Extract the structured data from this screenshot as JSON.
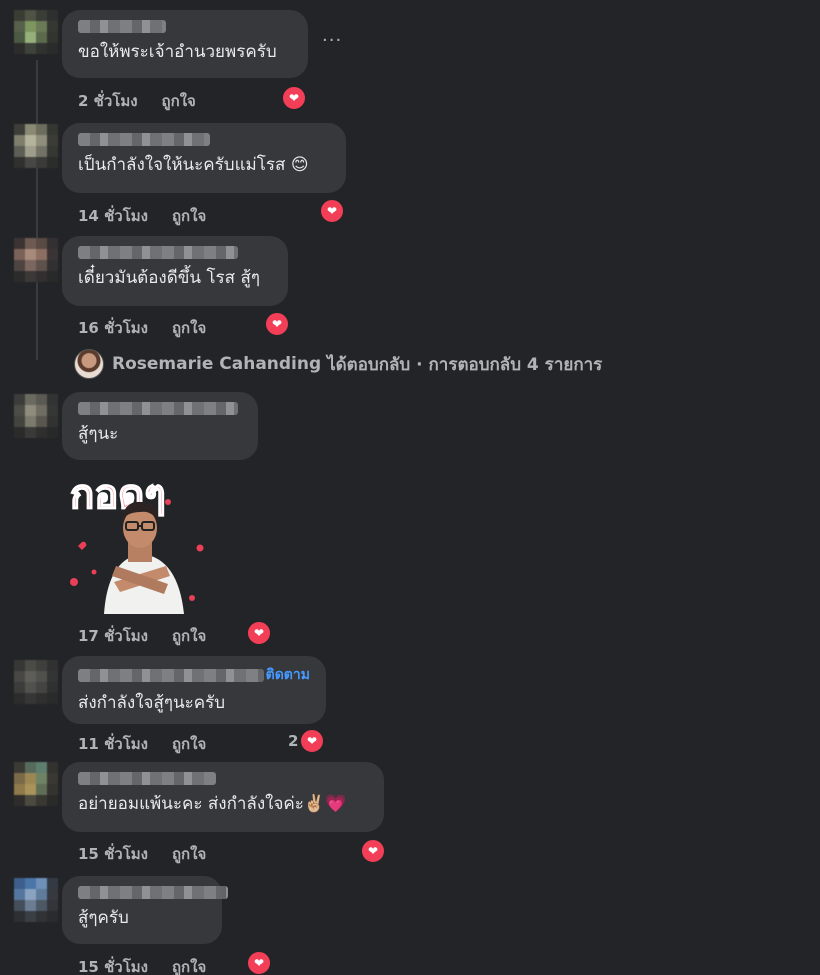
{
  "comments": [
    {
      "text": "ขอให้พระเจ้าอำนวยพรครับ",
      "time": "2 ชั่วโมง",
      "like": "ถูกใจ"
    },
    {
      "text": "เป็นกำลังใจให้นะครับแม่โรส",
      "emoji": "😊",
      "time": "14 ชั่วโมง",
      "like": "ถูกใจ"
    },
    {
      "text": "เดี๋ยวมันต้องดีขึ้น โรส สู้ๆ",
      "time": "16 ชั่วโมง",
      "like": "ถูกใจ"
    },
    {
      "text": "สู้ๆนะ",
      "time": "17 ชั่วโมง",
      "like": "ถูกใจ",
      "sticker_text": "กอดๆ"
    },
    {
      "text": "ส่งกำลังใจสู้ๆนะครับ",
      "follow": "ติดตาม",
      "time": "11 ชั่วโมง",
      "like": "ถูกใจ",
      "reaction_count": "2"
    },
    {
      "text": "อย่ายอมแพ้นะคะ ส่งกำลังใจค่ะ",
      "emoji": "✌🏼💗",
      "time": "15 ชั่วโมง",
      "like": "ถูกใจ"
    },
    {
      "text": "สู้ๆครับ",
      "time": "15 ชั่วโมง",
      "like": "ถูกใจ"
    }
  ],
  "more_options": "···",
  "replies": {
    "name": "Rosemarie Cahanding",
    "text": "ได้ตอบกลับ · การตอบกลับ 4 รายการ"
  },
  "reaction_icon": "heart-icon",
  "colors": {
    "background": "#232427",
    "bubble": "#37383c",
    "heart": "#f33e58",
    "link": "#4599ff"
  }
}
